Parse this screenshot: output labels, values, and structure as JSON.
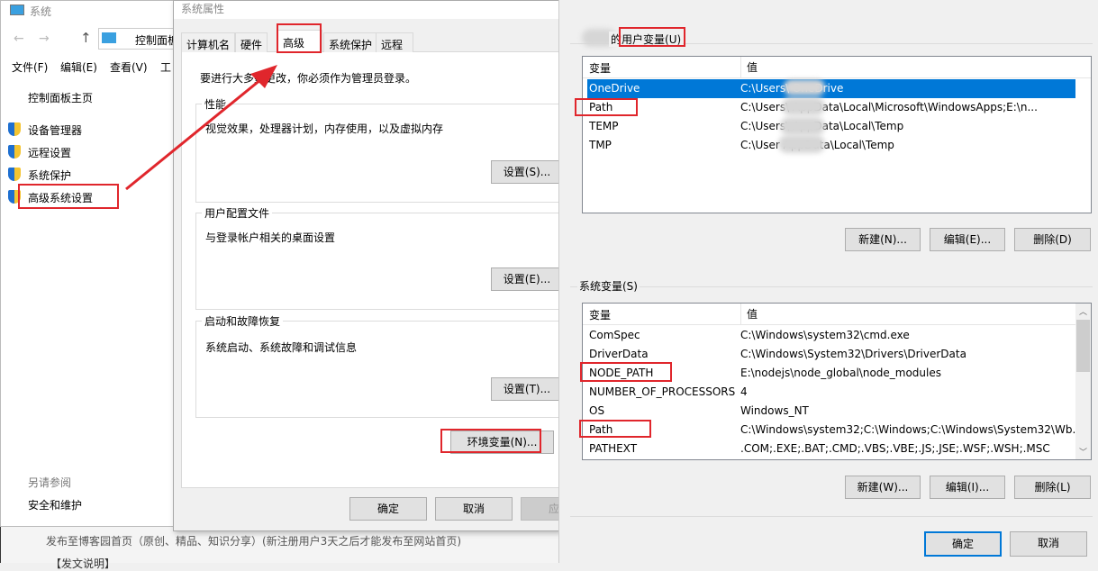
{
  "system_window": {
    "title": "系统",
    "address": "控制面板",
    "menu": [
      "文件(F)",
      "编辑(E)",
      "查看(V)",
      "工"
    ],
    "home": "控制面板主页",
    "links": [
      "设备管理器",
      "远程设置",
      "系统保护",
      "高级系统设置"
    ],
    "see_also": "另请参阅",
    "see_also_link": "安全和维护"
  },
  "blog": {
    "line1": "发布至博客园首页（原创、精品、知识分享）(新注册用户3天之后才能发布至网站首页)",
    "line2": "【发文说明】"
  },
  "system_properties": {
    "title": "系统属性",
    "tabs": [
      "计算机名",
      "硬件",
      "高级",
      "系统保护",
      "远程"
    ],
    "selected_tab": "高级",
    "notice": "要进行大多数更改，你必须作为管理员登录。",
    "groups": [
      {
        "label": "性能",
        "desc": "视觉效果，处理器计划，内存使用，以及虚拟内存",
        "button": "设置(S)..."
      },
      {
        "label": "用户配置文件",
        "desc": "与登录帐户相关的桌面设置",
        "button": "设置(E)..."
      },
      {
        "label": "启动和故障恢复",
        "desc": "系统启动、系统故障和调试信息",
        "button": "设置(T)..."
      }
    ],
    "env_button": "环境变量(N)...",
    "ok": "确定",
    "cancel": "取消",
    "apply": "应用"
  },
  "env_vars": {
    "user_label": "用户变量(U)",
    "user_label_prefix": "的",
    "col_var": "变量",
    "col_val": "值",
    "user_rows": [
      {
        "name": "OneDrive",
        "value": "C:\\Users\\        OneDrive",
        "selected": true
      },
      {
        "name": "Path",
        "value": "C:\\Users\\        AppData\\Local\\Microsoft\\WindowsApps;E:\\n..."
      },
      {
        "name": "TEMP",
        "value": "C:\\Users\\        AppData\\Local\\Temp"
      },
      {
        "name": "TMP",
        "value": "C:\\User         AppData\\Local\\Temp"
      }
    ],
    "user_buttons": [
      "新建(N)...",
      "编辑(E)...",
      "删除(D)"
    ],
    "sys_label": "系统变量(S)",
    "sys_rows": [
      {
        "name": "ComSpec",
        "value": "C:\\Windows\\system32\\cmd.exe"
      },
      {
        "name": "DriverData",
        "value": "C:\\Windows\\System32\\Drivers\\DriverData"
      },
      {
        "name": "NODE_PATH",
        "value": "E:\\nodejs\\node_global\\node_modules"
      },
      {
        "name": "NUMBER_OF_PROCESSORS",
        "value": "4"
      },
      {
        "name": "OS",
        "value": "Windows_NT"
      },
      {
        "name": "Path",
        "value": "C:\\Windows\\system32;C:\\Windows;C:\\Windows\\System32\\Wb..."
      },
      {
        "name": "PATHEXT",
        "value": ".COM;.EXE;.BAT;.CMD;.VBS;.VBE;.JS;.JSE;.WSF;.WSH;.MSC"
      }
    ],
    "sys_buttons": [
      "新建(W)...",
      "编辑(I)...",
      "删除(L)"
    ],
    "ok": "确定",
    "cancel": "取消"
  },
  "colors": {
    "selection": "#0078d7",
    "annotation": "#e0262c",
    "dialog_bg": "#f0f0f0"
  }
}
